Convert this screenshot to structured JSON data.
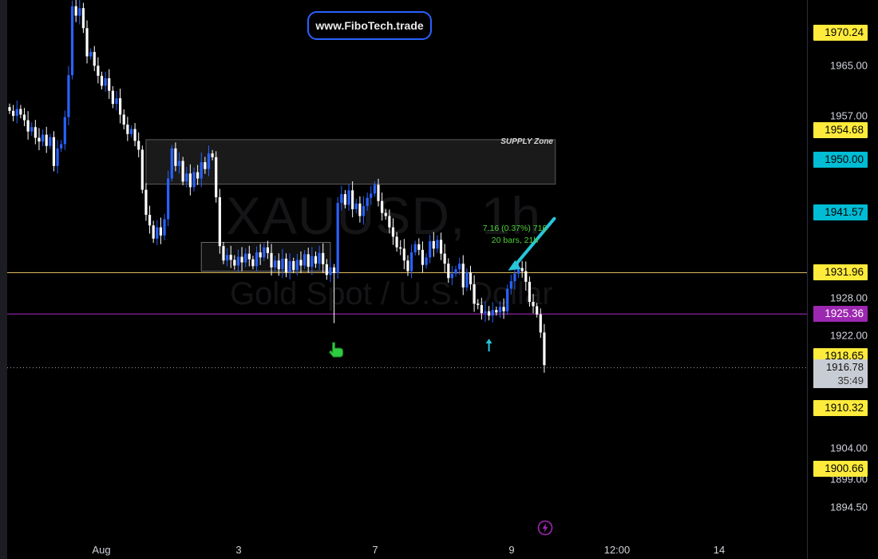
{
  "chart_data": {
    "type": "candlestick",
    "watermark_symbol": "XAUUSD, 1h",
    "watermark_description": "Gold Spot / U.S. Dollar",
    "brand": "www.FiboTech.trade",
    "y_ticks": [
      "1965.00",
      "1957.00",
      "1928.00",
      "1922.00",
      "1904.00",
      "1899.00",
      "1894.50"
    ],
    "x_ticks": [
      "Aug",
      "3",
      "7",
      "9",
      "12:00",
      "14"
    ],
    "price_tags": [
      {
        "value": "1970.24",
        "bg": "#ffeb3b",
        "fg": "#000000"
      },
      {
        "value": "1954.68",
        "bg": "#ffeb3b",
        "fg": "#000000"
      },
      {
        "value": "1950.00",
        "bg": "#00bcd4",
        "fg": "#000000"
      },
      {
        "value": "1941.57",
        "bg": "#00bcd4",
        "fg": "#000000"
      },
      {
        "value": "1931.96",
        "bg": "#ffeb3b",
        "fg": "#000000"
      },
      {
        "value": "1925.36",
        "bg": "#9c27b0",
        "fg": "#ffffff"
      },
      {
        "value": "1918.65",
        "bg": "#ffeb3b",
        "fg": "#000000"
      },
      {
        "value": "1910.32",
        "bg": "#ffeb3b",
        "fg": "#000000"
      },
      {
        "value": "1900.66",
        "bg": "#ffeb3b",
        "fg": "#000000"
      }
    ],
    "current_price": "1916.78",
    "countdown": "35:49",
    "horizontal_lines": [
      {
        "price": 1931.96,
        "color": "#d4b35a"
      },
      {
        "price": 1925.36,
        "color": "#9c27b0"
      }
    ],
    "supply_zone": {
      "label": "SUPPLY Zone",
      "top": 1953.2,
      "bottom": 1946.1
    },
    "consolidation_box": {
      "top": 1936.8,
      "bottom": 1932.2
    },
    "measure": {
      "line1": "7.16 (0.37%) 716",
      "line2": "20 bars, 21h"
    },
    "colors": {
      "up": "#2962ff",
      "down": "#ffffff",
      "zone": "#1a1a1a"
    },
    "ylim": [
      1889.3,
      1975.5
    ],
    "closes": [
      1957.8,
      1957.0,
      1958.1,
      1957.2,
      1956.3,
      1954.5,
      1955.2,
      1953.5,
      1952.9,
      1954.0,
      1952.2,
      1953.6,
      1949.0,
      1951.8,
      1952.5,
      1956.8,
      1963.5,
      1974.5,
      1973.0,
      1974.2,
      1971.0,
      1966.5,
      1967.2,
      1965.0,
      1963.4,
      1961.8,
      1963.0,
      1961.0,
      1958.9,
      1959.8,
      1957.2,
      1955.6,
      1954.1,
      1954.9,
      1953.0,
      1951.6,
      1945.2,
      1941.2,
      1939.5,
      1937.4,
      1939.2,
      1937.9,
      1940.5,
      1947.0,
      1951.8,
      1949.0,
      1949.8,
      1946.5,
      1947.8,
      1945.6,
      1948.0,
      1947.0,
      1949.6,
      1948.5,
      1951.0,
      1950.4,
      1944.0,
      1936.2,
      1933.9,
      1934.8,
      1934.0,
      1933.1,
      1934.5,
      1933.6,
      1935.0,
      1934.1,
      1933.0,
      1935.2,
      1934.4,
      1936.0,
      1935.1,
      1932.8,
      1933.9,
      1932.5,
      1934.2,
      1932.0,
      1933.8,
      1932.4,
      1934.0,
      1933.1,
      1934.9,
      1932.9,
      1934.6,
      1933.4,
      1935.1,
      1933.3,
      1931.6,
      1932.8,
      1931.9,
      1943.1,
      1944.5,
      1942.8,
      1945.1,
      1942.1,
      1943.0,
      1941.0,
      1942.6,
      1943.9,
      1944.6,
      1946.0,
      1943.4,
      1941.5,
      1941.0,
      1939.2,
      1937.7,
      1936.0,
      1935.8,
      1933.9,
      1932.2,
      1935.2,
      1936.5,
      1935.6,
      1933.2,
      1934.4,
      1937.0,
      1935.8,
      1937.2,
      1935.0,
      1933.4,
      1931.1,
      1931.8,
      1932.5,
      1933.4,
      1929.6,
      1932.0,
      1930.1,
      1927.0,
      1926.8,
      1925.5,
      1925.8,
      1925.1,
      1926.0,
      1925.6,
      1926.5,
      1925.8,
      1929.4,
      1930.6,
      1931.8,
      1932.7,
      1932.2,
      1930.5,
      1927.3,
      1926.6,
      1925.3,
      1922.4,
      1917.2
    ]
  }
}
